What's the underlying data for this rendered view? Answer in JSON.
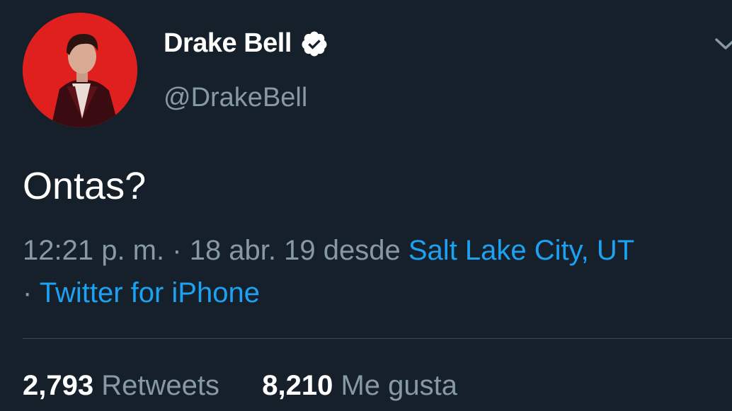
{
  "user": {
    "display_name": "Drake Bell",
    "handle": "@DrakeBell",
    "verified_icon": "verified-badge-icon",
    "avatar_bg": "#e0201f"
  },
  "tweet": {
    "text": "Ontas?",
    "time": "12:21 p. m.",
    "separator": "·",
    "date": "18 abr. 19",
    "from_word": "desde",
    "location": "Salt Lake City, UT",
    "client": "Twitter for iPhone"
  },
  "stats": {
    "retweets_count": "2,793",
    "retweets_label": "Retweets",
    "likes_count": "8,210",
    "likes_label": "Me gusta"
  },
  "colors": {
    "background": "#15202b",
    "text": "#ffffff",
    "secondary": "#8899a6",
    "link": "#1da1f2",
    "divider": "#38444d"
  },
  "icons": {
    "menu": "chevron-down-icon"
  }
}
